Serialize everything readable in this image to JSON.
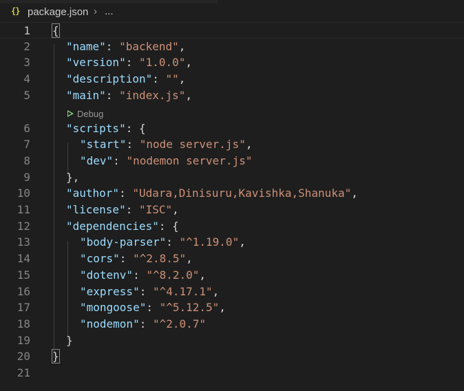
{
  "breadcrumb": {
    "icon": "{}",
    "file": "package.json",
    "separator": "›",
    "more": "..."
  },
  "codelens": {
    "label": "Debug"
  },
  "colors": {
    "background": "#1e1e1e",
    "key": "#9cdcfe",
    "string": "#ce9178",
    "punctuation": "#d4d4d4",
    "line_number": "#858585",
    "json_icon": "#cbcb41",
    "debug_icon": "#89d185"
  },
  "lines": [
    {
      "n": "1",
      "tokens": [
        {
          "t": "punc",
          "v": "{"
        }
      ]
    },
    {
      "n": "2",
      "tokens": [
        {
          "t": "key",
          "v": "\"name\""
        },
        {
          "t": "punc",
          "v": ": "
        },
        {
          "t": "str",
          "v": "\"backend\""
        },
        {
          "t": "punc",
          "v": ","
        }
      ]
    },
    {
      "n": "3",
      "tokens": [
        {
          "t": "key",
          "v": "\"version\""
        },
        {
          "t": "punc",
          "v": ": "
        },
        {
          "t": "str",
          "v": "\"1.0.0\""
        },
        {
          "t": "punc",
          "v": ","
        }
      ]
    },
    {
      "n": "4",
      "tokens": [
        {
          "t": "key",
          "v": "\"description\""
        },
        {
          "t": "punc",
          "v": ": "
        },
        {
          "t": "str",
          "v": "\"\""
        },
        {
          "t": "punc",
          "v": ","
        }
      ]
    },
    {
      "n": "5",
      "tokens": [
        {
          "t": "key",
          "v": "\"main\""
        },
        {
          "t": "punc",
          "v": ": "
        },
        {
          "t": "str",
          "v": "\"index.js\""
        },
        {
          "t": "punc",
          "v": ","
        }
      ]
    },
    {
      "n": "6",
      "tokens": [
        {
          "t": "key",
          "v": "\"scripts\""
        },
        {
          "t": "punc",
          "v": ": {"
        }
      ]
    },
    {
      "n": "7",
      "tokens": [
        {
          "t": "key",
          "v": "\"start\""
        },
        {
          "t": "punc",
          "v": ": "
        },
        {
          "t": "str",
          "v": "\"node server.js\""
        },
        {
          "t": "punc",
          "v": ","
        }
      ]
    },
    {
      "n": "8",
      "tokens": [
        {
          "t": "key",
          "v": "\"dev\""
        },
        {
          "t": "punc",
          "v": ": "
        },
        {
          "t": "str",
          "v": "\"nodemon server.js\""
        }
      ]
    },
    {
      "n": "9",
      "tokens": [
        {
          "t": "punc",
          "v": "},"
        }
      ]
    },
    {
      "n": "10",
      "tokens": [
        {
          "t": "key",
          "v": "\"author\""
        },
        {
          "t": "punc",
          "v": ": "
        },
        {
          "t": "str",
          "v": "\"Udara,Dinisuru,Kavishka,Shanuka\""
        },
        {
          "t": "punc",
          "v": ","
        }
      ]
    },
    {
      "n": "11",
      "tokens": [
        {
          "t": "key",
          "v": "\"license\""
        },
        {
          "t": "punc",
          "v": ": "
        },
        {
          "t": "str",
          "v": "\"ISC\""
        },
        {
          "t": "punc",
          "v": ","
        }
      ]
    },
    {
      "n": "12",
      "tokens": [
        {
          "t": "key",
          "v": "\"dependencies\""
        },
        {
          "t": "punc",
          "v": ": {"
        }
      ]
    },
    {
      "n": "13",
      "tokens": [
        {
          "t": "key",
          "v": "\"body-parser\""
        },
        {
          "t": "punc",
          "v": ": "
        },
        {
          "t": "str",
          "v": "\"^1.19.0\""
        },
        {
          "t": "punc",
          "v": ","
        }
      ]
    },
    {
      "n": "14",
      "tokens": [
        {
          "t": "key",
          "v": "\"cors\""
        },
        {
          "t": "punc",
          "v": ": "
        },
        {
          "t": "str",
          "v": "\"^2.8.5\""
        },
        {
          "t": "punc",
          "v": ","
        }
      ]
    },
    {
      "n": "15",
      "tokens": [
        {
          "t": "key",
          "v": "\"dotenv\""
        },
        {
          "t": "punc",
          "v": ": "
        },
        {
          "t": "str",
          "v": "\"^8.2.0\""
        },
        {
          "t": "punc",
          "v": ","
        }
      ]
    },
    {
      "n": "16",
      "tokens": [
        {
          "t": "key",
          "v": "\"express\""
        },
        {
          "t": "punc",
          "v": ": "
        },
        {
          "t": "str",
          "v": "\"^4.17.1\""
        },
        {
          "t": "punc",
          "v": ","
        }
      ]
    },
    {
      "n": "17",
      "tokens": [
        {
          "t": "key",
          "v": "\"mongoose\""
        },
        {
          "t": "punc",
          "v": ": "
        },
        {
          "t": "str",
          "v": "\"^5.12.5\""
        },
        {
          "t": "punc",
          "v": ","
        }
      ]
    },
    {
      "n": "18",
      "tokens": [
        {
          "t": "key",
          "v": "\"nodemon\""
        },
        {
          "t": "punc",
          "v": ": "
        },
        {
          "t": "str",
          "v": "\"^2.0.7\""
        }
      ]
    },
    {
      "n": "19",
      "tokens": [
        {
          "t": "punc",
          "v": "}"
        }
      ]
    },
    {
      "n": "20",
      "tokens": [
        {
          "t": "punc",
          "v": "}"
        }
      ]
    },
    {
      "n": "21",
      "tokens": []
    }
  ]
}
